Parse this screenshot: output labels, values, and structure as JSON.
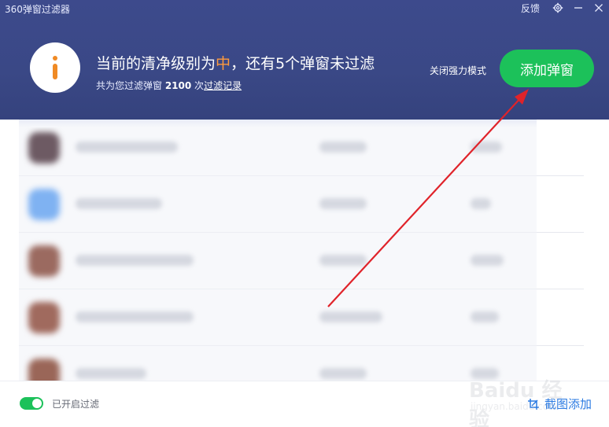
{
  "window": {
    "title": "360弹窗过滤器",
    "feedback_label": "反馈"
  },
  "header": {
    "status_prefix": "当前的清净级别为",
    "status_level": "中",
    "status_suffix": "，还有5个弹窗未过滤",
    "stats_prefix": "共为您过滤弹窗 ",
    "stats_count": "2100",
    "stats_mid": " 次",
    "stats_link": "过滤记录",
    "strong_mode_label": "关闭强力模式",
    "add_popup_label": "添加弹窗"
  },
  "footer": {
    "filter_toggle_on": true,
    "filter_label": "已开启过滤",
    "screenshot_add_label": "截图添加"
  },
  "watermark": {
    "brand": "Baidu 经验",
    "url": "jingyan.baidu.com"
  },
  "colors": {
    "header_bg": "#3a4886",
    "accent_green": "#1cc15a",
    "level_orange": "#ff9a3c",
    "link_blue": "#2a7ae2",
    "annotation_red": "#e0232a"
  },
  "icons": {
    "logo": "info-icon",
    "settings": "gear-icon",
    "minimize": "minimize-icon",
    "close": "close-icon",
    "screenshot": "crop-icon"
  }
}
